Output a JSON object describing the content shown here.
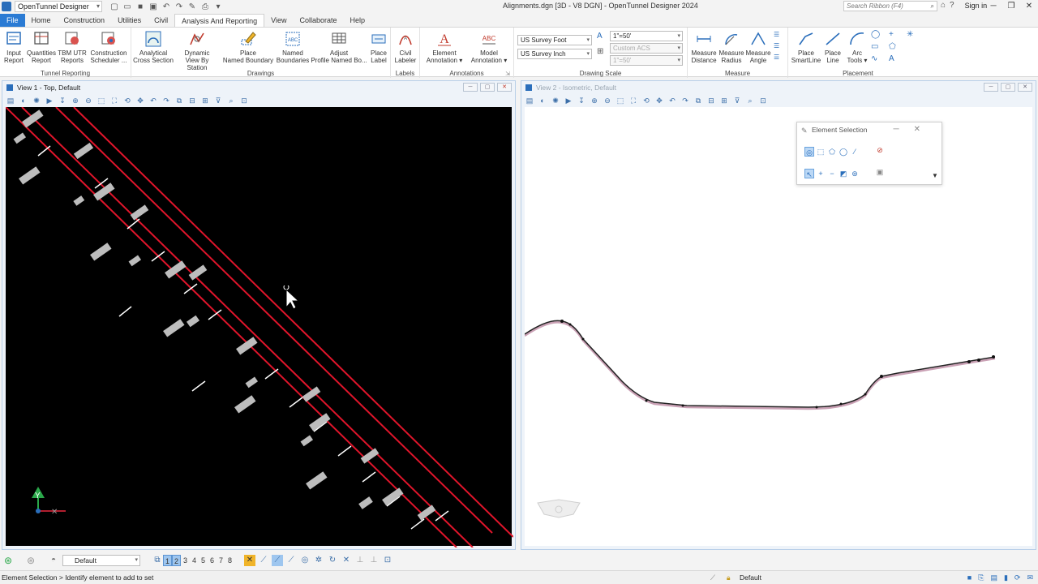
{
  "titlebar": {
    "app_selector": "OpenTunnel Designer",
    "document_title": "Alignments.dgn [3D - V8 DGN] - OpenTunnel Designer 2024",
    "search_placeholder": "Search Ribbon (F4)",
    "sign_in": "Sign in"
  },
  "tabs": [
    "File",
    "Home",
    "Construction",
    "Utilities",
    "Civil",
    "Analysis And Reporting",
    "View",
    "Collaborate",
    "Help"
  ],
  "active_tab": "Analysis And Reporting",
  "ribbon": {
    "tunnel_reporting": {
      "name": "Tunnel Reporting",
      "buttons": [
        {
          "l1": "Input",
          "l2": "Report"
        },
        {
          "l1": "Quantities",
          "l2": "Report"
        },
        {
          "l1": "TBM UTR",
          "l2": "Reports"
        },
        {
          "l1": "Construction",
          "l2": "Scheduler ..."
        }
      ]
    },
    "drawings": {
      "name": "Drawings",
      "buttons": [
        {
          "l1": "Analytical",
          "l2": "Cross Section"
        },
        {
          "l1": "Dynamic",
          "l2": "View By Station"
        },
        {
          "l1": "Place",
          "l2": "Named Boundary"
        },
        {
          "l1": "Named",
          "l2": "Boundaries"
        },
        {
          "l1": "Adjust",
          "l2": "Profile Named Bo..."
        },
        {
          "l1": "Place",
          "l2": "Label"
        }
      ]
    },
    "labels": {
      "name": "Labels",
      "buttons": [
        {
          "l1": "Civil",
          "l2": "Labeler"
        }
      ]
    },
    "annotations": {
      "name": "Annotations",
      "buttons": [
        {
          "l1": "Element",
          "l2": "Annotation ▾"
        },
        {
          "l1": "Model",
          "l2": "Annotation ▾"
        }
      ],
      "icon_text": "ABC"
    },
    "drawing_scale": {
      "name": "Drawing Scale",
      "unit1": "US Survey Foot",
      "unit2": "US Survey Inch",
      "scale1": "1\"=50'",
      "acs": "Custom ACS",
      "scale2": "1\"=50'"
    },
    "measure": {
      "name": "Measure",
      "buttons": [
        {
          "l1": "Measure",
          "l2": "Distance"
        },
        {
          "l1": "Measure",
          "l2": "Radius"
        },
        {
          "l1": "Measure",
          "l2": "Angle"
        }
      ]
    },
    "placement": {
      "name": "Placement",
      "buttons": [
        {
          "l1": "Place",
          "l2": "SmartLine"
        },
        {
          "l1": "Place",
          "l2": "Line"
        },
        {
          "l1": "Arc",
          "l2": "Tools ▾"
        }
      ]
    }
  },
  "view1": {
    "title": "View 1 - Top, Default"
  },
  "view2": {
    "title": "View 2 - Isometric, Default"
  },
  "element_selection": {
    "title": "Element Selection"
  },
  "bottom": {
    "level": "Default",
    "view_numbers": [
      "1",
      "2",
      "3",
      "4",
      "5",
      "6",
      "7",
      "8"
    ],
    "active_views": [
      "1",
      "2"
    ]
  },
  "status": {
    "message": "Element Selection > Identify element to add to set",
    "active_level": "Default"
  },
  "colors": {
    "file_tab": "#2b7bd4",
    "accent": "#2a6ebb",
    "alignment_red": "#e0152b",
    "canvas_black": "#000000"
  }
}
